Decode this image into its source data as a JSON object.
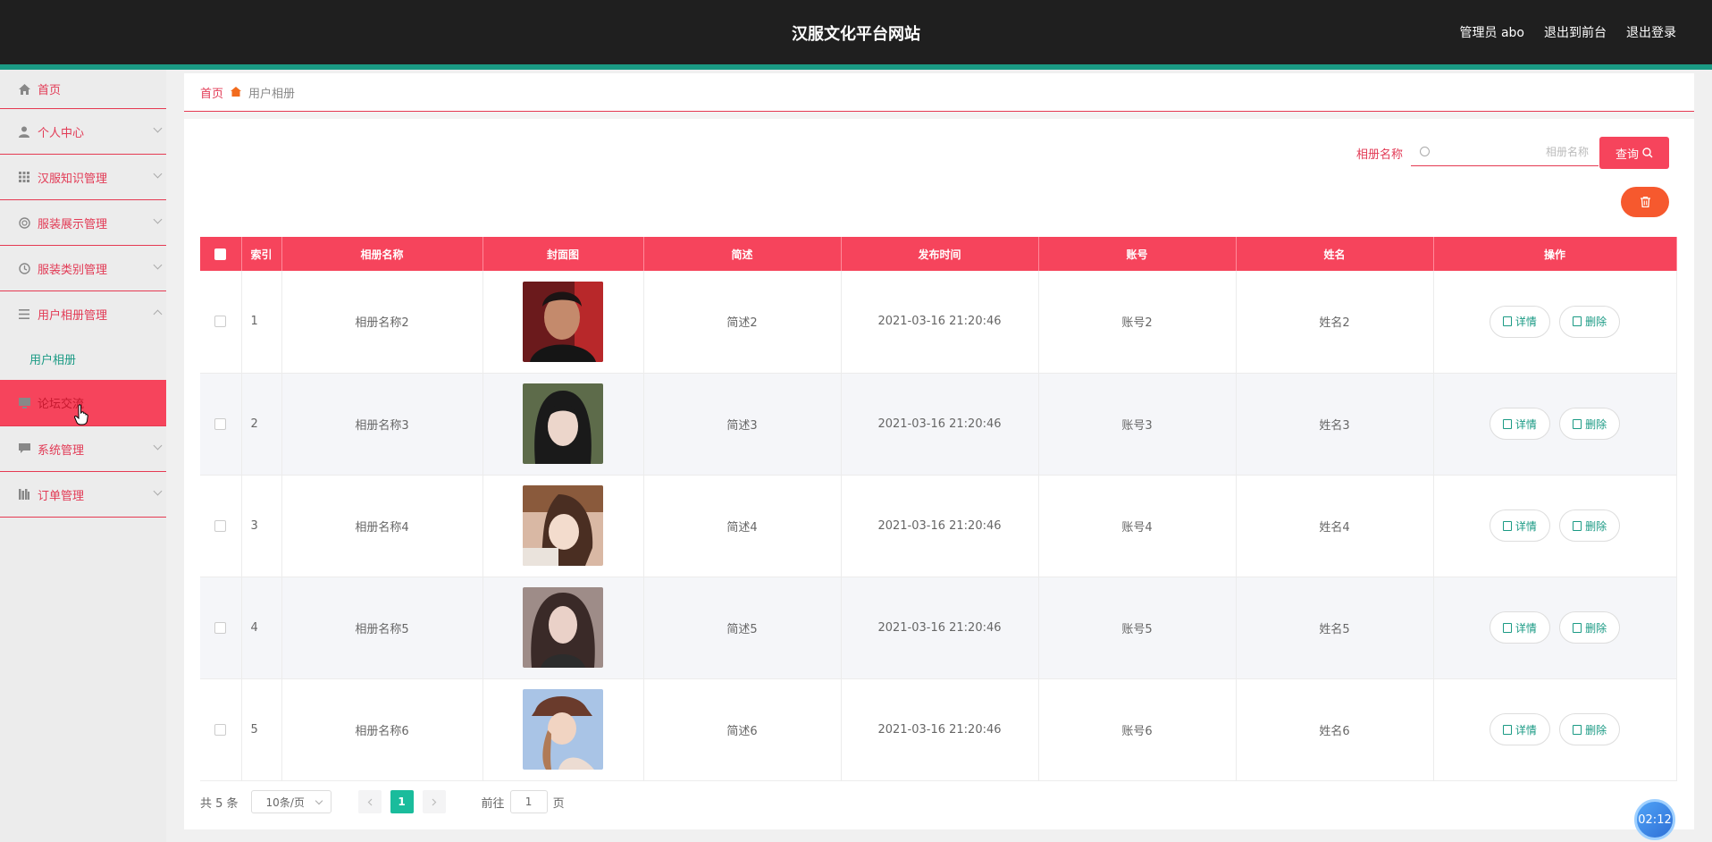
{
  "header": {
    "title": "汉服文化平台网站",
    "user": "管理员 abo",
    "back_front": "退出到前台",
    "logout": "退出登录"
  },
  "sidebar": {
    "items": [
      {
        "label": "首页",
        "icon": "home-icon"
      },
      {
        "label": "个人中心",
        "icon": "user-icon"
      },
      {
        "label": "汉服知识管理",
        "icon": "grid-icon"
      },
      {
        "label": "服装展示管理",
        "icon": "circle-icon"
      },
      {
        "label": "服装类别管理",
        "icon": "clock-icon"
      },
      {
        "label": "用户相册管理",
        "icon": "list-icon"
      },
      {
        "label": "论坛交流",
        "icon": "monitor-icon"
      },
      {
        "label": "系统管理",
        "icon": "chat-icon"
      },
      {
        "label": "订单管理",
        "icon": "bars-icon"
      }
    ],
    "subitem": "用户相册"
  },
  "breadcrumb": {
    "home": "首页",
    "current": "用户相册"
  },
  "search": {
    "label": "相册名称",
    "placeholder": "相册名称",
    "button": "查询"
  },
  "table": {
    "headers": [
      "索引",
      "相册名称",
      "封面图",
      "简述",
      "发布时间",
      "账号",
      "姓名",
      "操作"
    ],
    "rows": [
      {
        "index": "1",
        "name": "相册名称2",
        "desc": "简述2",
        "time": "2021-03-16 21:20:46",
        "account": "账号2",
        "person": "姓名2"
      },
      {
        "index": "2",
        "name": "相册名称3",
        "desc": "简述3",
        "time": "2021-03-16 21:20:46",
        "account": "账号3",
        "person": "姓名3"
      },
      {
        "index": "3",
        "name": "相册名称4",
        "desc": "简述4",
        "time": "2021-03-16 21:20:46",
        "account": "账号4",
        "person": "姓名4"
      },
      {
        "index": "4",
        "name": "相册名称5",
        "desc": "简述5",
        "time": "2021-03-16 21:20:46",
        "account": "账号5",
        "person": "姓名5"
      },
      {
        "index": "5",
        "name": "相册名称6",
        "desc": "简述6",
        "time": "2021-03-16 21:20:46",
        "account": "账号6",
        "person": "姓名6"
      }
    ],
    "detail_label": "详情",
    "delete_label": "删除"
  },
  "pager": {
    "total": "共 5 条",
    "page_size": "10条/页",
    "current_page": "1",
    "goto_prefix": "前往",
    "goto_value": "1",
    "goto_suffix": "页"
  },
  "timer": "02:12",
  "colors": {
    "accent": "#f6445c",
    "header_bg": "#1f1f1f",
    "teal": "#1a9a84",
    "orange": "#f6592e"
  }
}
